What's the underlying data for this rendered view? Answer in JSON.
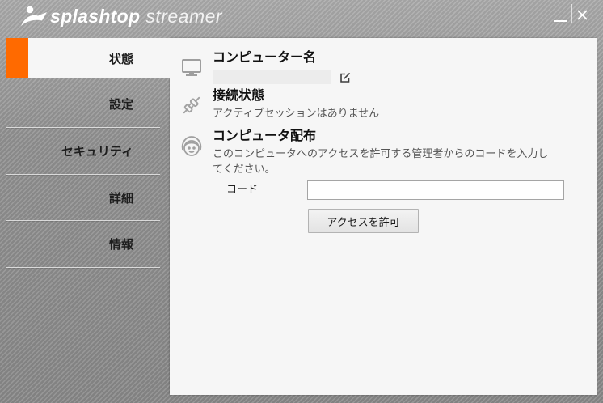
{
  "app": {
    "brand_bold": "splashtop",
    "brand_light": "streamer",
    "logo_icon": "splashtop-logo-icon"
  },
  "window": {
    "minimize_icon": "minimize-icon",
    "close_icon": "close-icon"
  },
  "sidebar": {
    "items": [
      {
        "label": "状態",
        "active": true
      },
      {
        "label": "設定",
        "active": false
      },
      {
        "label": "セキュリティ",
        "active": false
      },
      {
        "label": "詳細",
        "active": false
      },
      {
        "label": "情報",
        "active": false
      }
    ]
  },
  "status": {
    "computer_name": {
      "icon": "monitor-icon",
      "title": "コンピューター名",
      "value": "",
      "edit_icon": "edit-icon"
    },
    "connection": {
      "icon": "plug-icon",
      "title": "接続状態",
      "text": "アクティブセッションはありません"
    },
    "deployment": {
      "icon": "support-face-icon",
      "title": "コンピュータ配布",
      "description_lines": [
        "このコンピュータへのアクセスを許可する管理者からのコードを入力し",
        "てください。"
      ],
      "code_label": "コード",
      "code_value": "",
      "grant_button_label": "アクセスを許可"
    }
  },
  "colors": {
    "accent": "#ff6a00",
    "panel": "#f6f6f6",
    "icon_gray": "#a0a0a0"
  }
}
